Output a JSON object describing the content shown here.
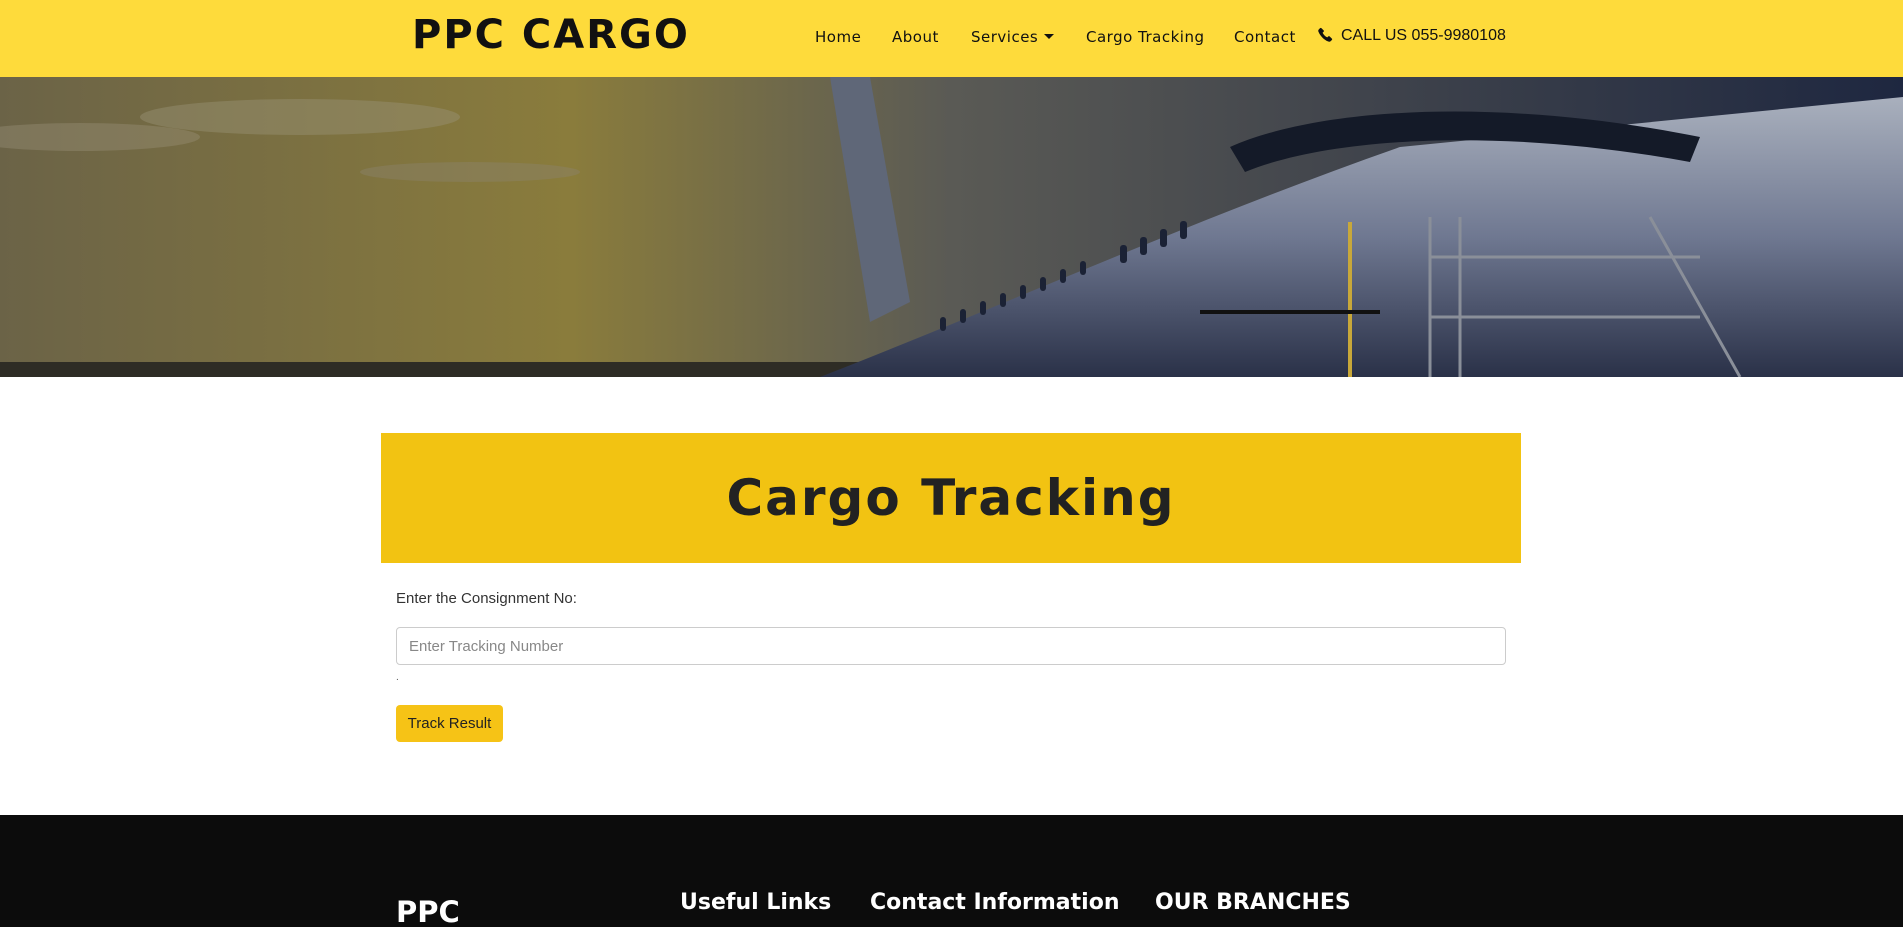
{
  "navbar": {
    "brand": "PPC CARGO",
    "items": [
      {
        "label": "Home"
      },
      {
        "label": "About"
      },
      {
        "label": "Services"
      },
      {
        "label": "Cargo Tracking"
      },
      {
        "label": "Contact"
      }
    ],
    "call": "CALL US 055-9980108",
    "background": "#fedb3b"
  },
  "tracking": {
    "title": "Cargo Tracking",
    "label": "Enter the Consignment No:",
    "placeholder": "Enter Tracking Number",
    "value": "",
    "dot": ".",
    "button": "Track Result",
    "accent": "#f2c312"
  },
  "footer": {
    "brand": "PPC",
    "headings": [
      "Useful Links",
      "Contact Information",
      "OUR BRANCHES"
    ],
    "background": "#0c0c0c"
  },
  "icons": {
    "phone": "phone-icon",
    "dropdown": "chevron-down-icon"
  }
}
